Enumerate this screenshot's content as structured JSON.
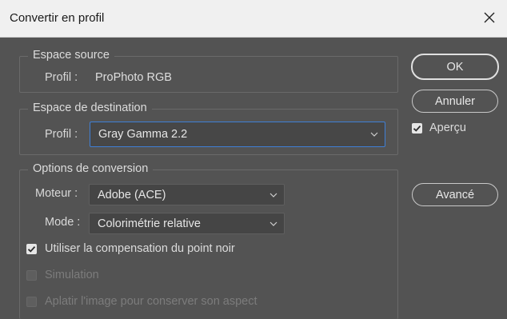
{
  "window": {
    "title": "Convertir en profil"
  },
  "source": {
    "legend": "Espace source",
    "profile_label": "Profil :",
    "profile_value": "ProPhoto RGB"
  },
  "destination": {
    "legend": "Espace de destination",
    "profile_label": "Profil :",
    "profile_value": "Gray Gamma 2.2"
  },
  "conversion": {
    "legend": "Options de conversion",
    "engine_label": "Moteur :",
    "engine_value": "Adobe (ACE)",
    "mode_label": "Mode :",
    "mode_value": "Colorimétrie relative",
    "blackpoint": {
      "label": "Utiliser la compensation du point noir",
      "checked": true
    },
    "simulation": {
      "label": "Simulation",
      "checked": false,
      "enabled": false
    },
    "flatten": {
      "label": "Aplatir l'image pour conserver son aspect",
      "checked": false,
      "enabled": false
    }
  },
  "buttons": {
    "ok": "OK",
    "cancel": "Annuler",
    "advanced": "Avancé"
  },
  "preview": {
    "label": "Aperçu",
    "checked": true
  },
  "colors": {
    "dialog_bg": "#535353",
    "focus_border": "#3f7fd6",
    "titlebar_bg": "#f0f0f0"
  }
}
